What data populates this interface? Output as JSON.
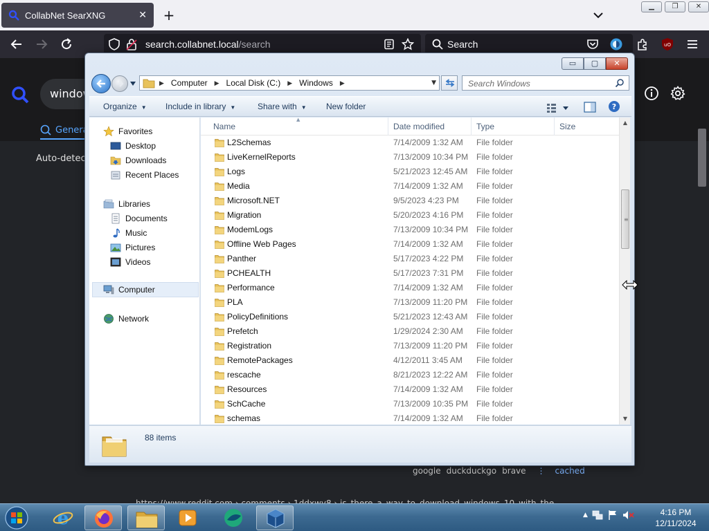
{
  "browser": {
    "tab_title": "CollabNet SearXNG",
    "url_host": "search.collabnet.local",
    "url_path": "/search",
    "search_placeholder": "Search",
    "new_tab": "+",
    "tab_close": "✕"
  },
  "searx": {
    "query_fragment": "window",
    "tab_general": "Genera",
    "autodetect": "Auto-detect",
    "engines": [
      "google",
      "duckduckgo",
      "brave"
    ],
    "separator": "⋮",
    "cached": "cached",
    "result_url": "https://www.reddit.com › comments › 1ddxwy8 › is_there_a_way_to_download_windows_10_with_the"
  },
  "explorer": {
    "caption_buttons": {
      "min": "▭",
      "max": "▢",
      "close": "✕"
    },
    "breadcrumb": [
      "Computer",
      "Local Disk (C:)",
      "Windows"
    ],
    "search_placeholder": "Search Windows",
    "toolbar": {
      "organize": "Organize",
      "include": "Include in library",
      "share": "Share with",
      "new_folder": "New folder"
    },
    "nav": {
      "favorites": "Favorites",
      "desktop": "Desktop",
      "downloads": "Downloads",
      "recent": "Recent Places",
      "libraries": "Libraries",
      "documents": "Documents",
      "music": "Music",
      "pictures": "Pictures",
      "videos": "Videos",
      "computer": "Computer",
      "network": "Network"
    },
    "columns": {
      "name": "Name",
      "date": "Date modified",
      "type": "Type",
      "size": "Size"
    },
    "rows": [
      {
        "name": "L2Schemas",
        "date": "7/14/2009 1:32 AM",
        "type": "File folder"
      },
      {
        "name": "LiveKernelReports",
        "date": "7/13/2009 10:34 PM",
        "type": "File folder"
      },
      {
        "name": "Logs",
        "date": "5/21/2023 12:45 AM",
        "type": "File folder"
      },
      {
        "name": "Media",
        "date": "7/14/2009 1:32 AM",
        "type": "File folder"
      },
      {
        "name": "Microsoft.NET",
        "date": "9/5/2023 4:23 PM",
        "type": "File folder"
      },
      {
        "name": "Migration",
        "date": "5/20/2023 4:16 PM",
        "type": "File folder"
      },
      {
        "name": "ModemLogs",
        "date": "7/13/2009 10:34 PM",
        "type": "File folder"
      },
      {
        "name": "Offline Web Pages",
        "date": "7/14/2009 1:32 AM",
        "type": "File folder"
      },
      {
        "name": "Panther",
        "date": "5/17/2023 4:22 PM",
        "type": "File folder"
      },
      {
        "name": "PCHEALTH",
        "date": "5/17/2023 7:31 PM",
        "type": "File folder"
      },
      {
        "name": "Performance",
        "date": "7/14/2009 1:32 AM",
        "type": "File folder"
      },
      {
        "name": "PLA",
        "date": "7/13/2009 11:20 PM",
        "type": "File folder"
      },
      {
        "name": "PolicyDefinitions",
        "date": "5/21/2023 12:43 AM",
        "type": "File folder"
      },
      {
        "name": "Prefetch",
        "date": "1/29/2024 2:30 AM",
        "type": "File folder"
      },
      {
        "name": "Registration",
        "date": "7/13/2009 11:20 PM",
        "type": "File folder"
      },
      {
        "name": "RemotePackages",
        "date": "4/12/2011 3:45 AM",
        "type": "File folder"
      },
      {
        "name": "rescache",
        "date": "8/21/2023 12:22 AM",
        "type": "File folder"
      },
      {
        "name": "Resources",
        "date": "7/14/2009 1:32 AM",
        "type": "File folder"
      },
      {
        "name": "SchCache",
        "date": "7/13/2009 10:35 PM",
        "type": "File folder"
      },
      {
        "name": "schemas",
        "date": "7/14/2009 1:32 AM",
        "type": "File folder"
      }
    ],
    "item_count": "88 items"
  },
  "taskbar": {
    "time": "4:16 PM",
    "date": "12/11/2024"
  },
  "colors": {
    "folder": "#e8c25a",
    "searx_accent": "#58a6ff",
    "explorer_text": "#1e395b"
  }
}
